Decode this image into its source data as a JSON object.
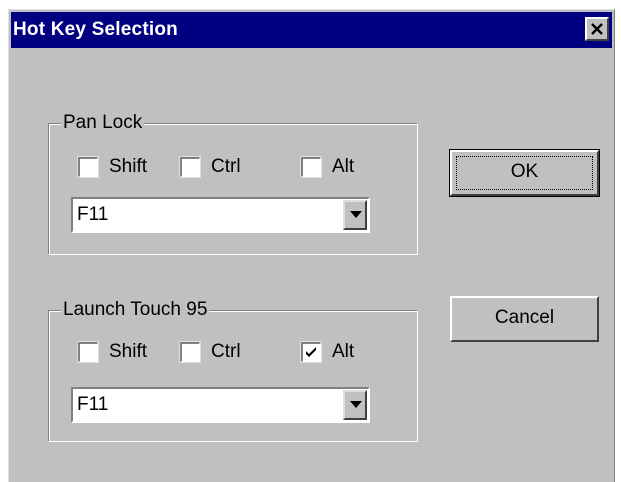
{
  "window": {
    "title": "Hot Key Selection"
  },
  "groups": [
    {
      "legend": "Pan Lock",
      "modifiers": [
        {
          "label": "Shift",
          "checked": false
        },
        {
          "label": "Ctrl",
          "checked": false
        },
        {
          "label": "Alt",
          "checked": false
        }
      ],
      "key": "F11"
    },
    {
      "legend": "Launch Touch 95",
      "modifiers": [
        {
          "label": "Shift",
          "checked": false
        },
        {
          "label": "Ctrl",
          "checked": false
        },
        {
          "label": "Alt",
          "checked": true
        }
      ],
      "key": "F11"
    }
  ],
  "buttons": {
    "ok_label": "OK",
    "cancel_label": "Cancel"
  },
  "icons": {
    "close": "close-icon",
    "dropdown": "chevron-down-icon",
    "check": "checkmark-icon"
  }
}
